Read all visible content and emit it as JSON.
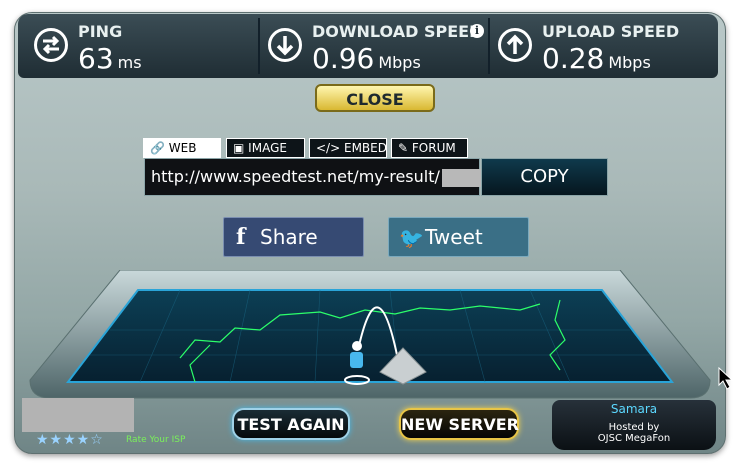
{
  "stats": [
    {
      "label": "PING",
      "value": "63",
      "unit": "ms",
      "icon": "ping-arrows-icon"
    },
    {
      "label": "DOWNLOAD SPEED",
      "value": "0.96",
      "unit": "Mbps",
      "icon": "download-arrow-icon"
    },
    {
      "label": "UPLOAD SPEED",
      "value": "0.28",
      "unit": "Mbps",
      "icon": "upload-arrow-icon"
    }
  ],
  "close_label": "CLOSE",
  "share_tabs": [
    {
      "label": "WEB",
      "icon": "link-icon",
      "active": true
    },
    {
      "label": "IMAGE",
      "icon": "image-icon",
      "active": false
    },
    {
      "label": "EMBED",
      "icon": "code-icon",
      "active": false
    },
    {
      "label": "FORUM",
      "icon": "edit-icon",
      "active": false
    }
  ],
  "result_url": "http://www.speedtest.net/my-result/",
  "copy_label": "COPY",
  "social": {
    "share_label": "Share",
    "tweet_label": "Tweet"
  },
  "bottom": {
    "rating_stars": "★★★★☆",
    "rate_isp_label": "Rate Your ISP",
    "test_again_label": "TEST AGAIN",
    "new_server_label": "NEW SERVER",
    "server_city": "Samara",
    "hosted_by_label": "Hosted by",
    "isp_name": "OJSC MegaFon"
  },
  "colors": {
    "accent_blue": "#46b7e6",
    "accent_gold": "#e8c546",
    "map_green": "#2cff6a"
  }
}
